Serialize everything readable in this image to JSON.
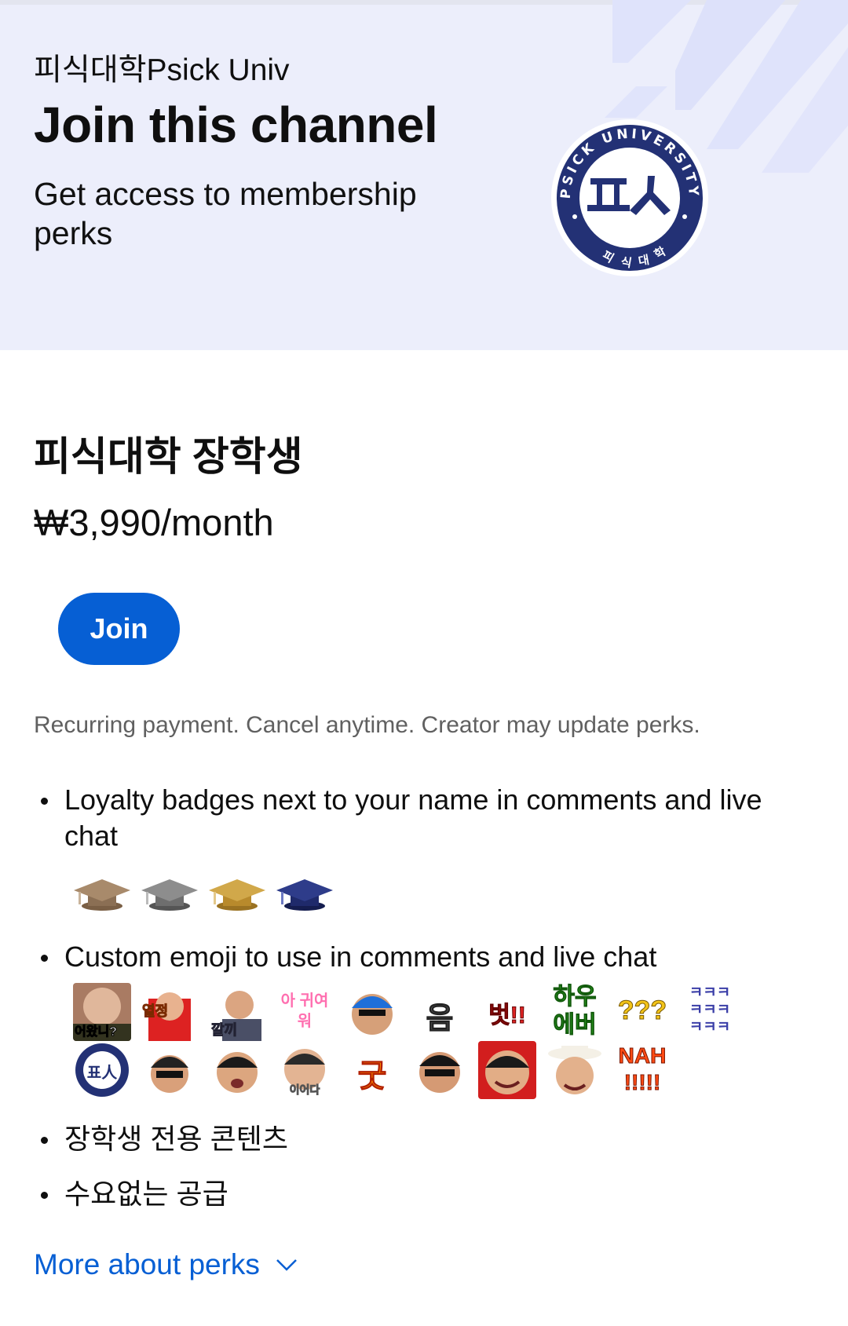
{
  "header": {
    "channel_name": "피식대학Psick Univ",
    "title": "Join this channel",
    "subtitle": "Get access to membership perks",
    "logo": {
      "center_text": "피식",
      "center_glyph": "프人",
      "ring_text_top": "PSICK UNIVERSITY",
      "ring_text_bottom": "피식대학"
    },
    "bg_color": "#eceefb"
  },
  "tier": {
    "name": "피식대학 장학생",
    "price": "₩3,990/month",
    "join_label": "Join",
    "disclaimer": "Recurring payment. Cancel anytime. Creator may update perks."
  },
  "perks": [
    {
      "text": "Loyalty badges next to your name in comments and live chat"
    },
    {
      "text": "Custom emoji to use in comments and live chat"
    },
    {
      "text": "장학생 전용 콘텐츠"
    },
    {
      "text": "수요없는 공급"
    }
  ],
  "badges": [
    {
      "name": "brown-graduation-cap-icon",
      "color": "#8b6f54"
    },
    {
      "name": "gray-graduation-cap-icon",
      "color": "#6e6e6e"
    },
    {
      "name": "gold-graduation-cap-icon",
      "color": "#b88a2c"
    },
    {
      "name": "navy-graduation-cap-icon",
      "color": "#1f2a6b"
    }
  ],
  "emoji": [
    {
      "label": "어왔니?"
    },
    {
      "label": "열정"
    },
    {
      "label": "깔끼"
    },
    {
      "label": "아 귀여워"
    },
    {
      "label": ""
    },
    {
      "label": "음"
    },
    {
      "label": "벗!!"
    },
    {
      "label": "하우 에버"
    },
    {
      "label": "???"
    },
    {
      "label": "ㅋㅋㅋ ㅋㅋㅋ ㅋㅋㅋ"
    },
    {
      "label": "표人"
    },
    {
      "label": ""
    },
    {
      "label": ""
    },
    {
      "label": "이어다"
    },
    {
      "label": "굿"
    },
    {
      "label": ""
    },
    {
      "label": ""
    },
    {
      "label": ""
    },
    {
      "label": "NAH !!!!!"
    }
  ],
  "more_link": "More about perks"
}
